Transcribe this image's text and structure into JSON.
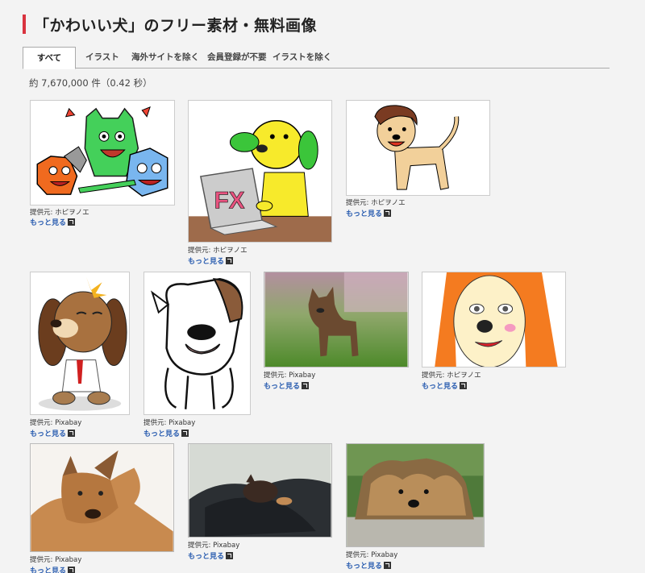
{
  "page": {
    "title": "「かわいい犬」のフリー素材・無料画像",
    "result_count": "約 7,670,000 件（0.42 秒）"
  },
  "tabs": [
    {
      "label": "すべて",
      "active": true
    },
    {
      "label": "イラスト",
      "active": false
    },
    {
      "label": "海外サイトを除く",
      "active": false
    },
    {
      "label": "会員登録が不要",
      "active": false
    },
    {
      "label": "イラストを除く",
      "active": false
    }
  ],
  "results": [
    {
      "credit": "提供元: ホピヲノエ",
      "more": "もっと見る",
      "subject": "three-monsters-illustration"
    },
    {
      "credit": "提供元: ホピヲノエ",
      "more": "もっと見る",
      "subject": "yellow-dog-fx-laptop-illustration"
    },
    {
      "credit": "提供元: ホピヲノエ",
      "more": "もっと見る",
      "subject": "tan-dog-illustration"
    },
    {
      "credit": "提供元: Pixabay",
      "more": "もっと見る",
      "subject": "cartoon-dog-necktie"
    },
    {
      "credit": "提供元: Pixabay",
      "more": "もっと見る",
      "subject": "bulldog-line-art"
    },
    {
      "credit": "提供元: Pixabay",
      "more": "もっと見る",
      "subject": "puppy-on-grass-photo"
    },
    {
      "credit": "提供元: ホピヲノエ",
      "more": "もっと見る",
      "subject": "woman-face-illustration"
    },
    {
      "credit": "提供元: Pixabay",
      "more": "もっと見る",
      "subject": "shepherd-puppy-photo"
    },
    {
      "credit": "提供元: Pixabay",
      "more": "もっと見る",
      "subject": "sleeping-dog-blanket-photo"
    },
    {
      "credit": "提供元: Pixabay",
      "more": "もっと見る",
      "subject": "yorkshire-terrier-photo"
    }
  ],
  "colors": {
    "accent": "#d9333f",
    "link": "#2a5db0",
    "background": "#f3f3f3"
  }
}
